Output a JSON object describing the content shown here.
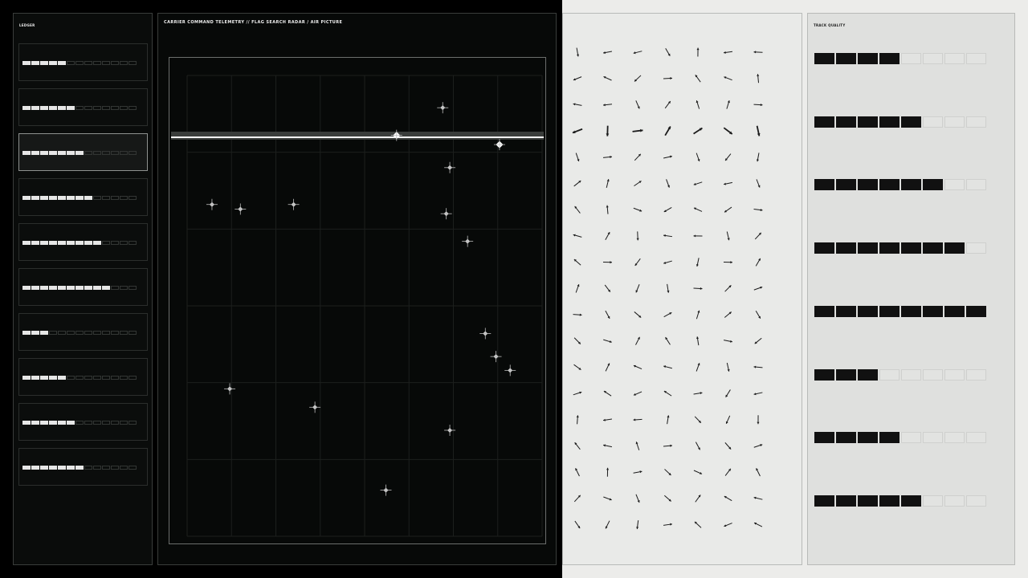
{
  "ledger": {
    "title": "LEDGER",
    "subtitle": "",
    "cards": [
      {
        "code": "",
        "alt": "",
        "filled": 5,
        "total": 13
      },
      {
        "code": "",
        "alt": "",
        "filled": 6,
        "total": 13
      },
      {
        "code": "",
        "alt": "",
        "filled": 7,
        "total": 13,
        "active": true
      },
      {
        "code": "",
        "alt": "",
        "filled": 8,
        "total": 13
      },
      {
        "code": "",
        "alt": "",
        "filled": 9,
        "total": 13
      },
      {
        "code": "",
        "alt": "",
        "filled": 10,
        "total": 13
      },
      {
        "code": "",
        "alt": "",
        "filled": 3,
        "total": 13
      },
      {
        "code": "",
        "alt": "",
        "filled": 5,
        "total": 13
      },
      {
        "code": "",
        "alt": "",
        "filled": 6,
        "total": 13
      },
      {
        "code": "",
        "alt": "",
        "filled": 7,
        "total": 13
      }
    ]
  },
  "radar": {
    "title": "CARRIER COMMAND TELEMETRY  //  FLAG SEARCH RADAR / AIR PICTURE",
    "meta_line": "",
    "mode_line": "",
    "scope_title": "",
    "contacts": [
      {
        "id": "",
        "col": 0.72,
        "row": 0.07
      },
      {
        "id": "",
        "col": 0.59,
        "row": 0.13,
        "selected": true
      },
      {
        "id": "",
        "col": 0.88,
        "row": 0.15,
        "selected": true
      },
      {
        "id": "",
        "col": 0.74,
        "row": 0.2
      },
      {
        "id": "",
        "col": 0.07,
        "row": 0.28
      },
      {
        "id": "",
        "col": 0.15,
        "row": 0.29
      },
      {
        "id": "",
        "col": 0.3,
        "row": 0.28
      },
      {
        "id": "",
        "col": 0.73,
        "row": 0.3
      },
      {
        "id": "",
        "col": 0.79,
        "row": 0.36
      },
      {
        "id": "",
        "col": 0.87,
        "row": 0.61
      },
      {
        "id": "",
        "col": 0.91,
        "row": 0.64
      },
      {
        "id": "",
        "col": 0.84,
        "row": 0.56
      },
      {
        "id": "",
        "col": 0.12,
        "row": 0.68
      },
      {
        "id": "",
        "col": 0.36,
        "row": 0.72
      },
      {
        "id": "",
        "col": 0.74,
        "row": 0.77
      },
      {
        "id": "",
        "col": 0.56,
        "row": 0.9
      }
    ]
  },
  "vector_field": {
    "title": "",
    "subtitle": ""
  },
  "quality": {
    "title": "TRACK QUALITY",
    "rows": [
      {
        "label": "",
        "value": "",
        "filled": 4,
        "total": 8
      },
      {
        "label": "",
        "value": "",
        "filled": 5,
        "total": 8
      },
      {
        "label": "",
        "value": "",
        "filled": 6,
        "total": 8
      },
      {
        "label": "",
        "value": "",
        "filled": 7,
        "total": 8
      },
      {
        "label": "",
        "value": "",
        "filled": 8,
        "total": 8
      },
      {
        "label": "",
        "value": "",
        "filled": 3,
        "total": 8
      },
      {
        "label": "",
        "value": "",
        "filled": 4,
        "total": 8
      },
      {
        "label": "",
        "value": "",
        "filled": 5,
        "total": 8
      }
    ]
  }
}
